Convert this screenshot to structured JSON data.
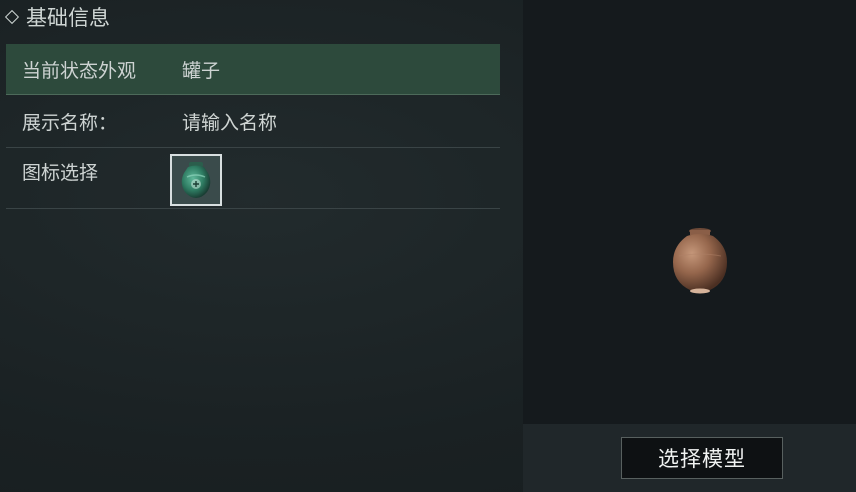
{
  "section": {
    "title": "基础信息"
  },
  "rows": {
    "appearance": {
      "label": "当前状态外观",
      "value": "罐子"
    },
    "display_name": {
      "label": "展示名称：",
      "placeholder": "请输入名称"
    },
    "icon": {
      "label": "图标选择",
      "icon_name": "green-jar-icon"
    }
  },
  "preview": {
    "model_name": "jar-model",
    "select_button_label": "选择模型"
  },
  "colors": {
    "selected_row": "#2d4a3c",
    "panel_bg": "#1b2225",
    "preview_bg": "#151a1d"
  }
}
